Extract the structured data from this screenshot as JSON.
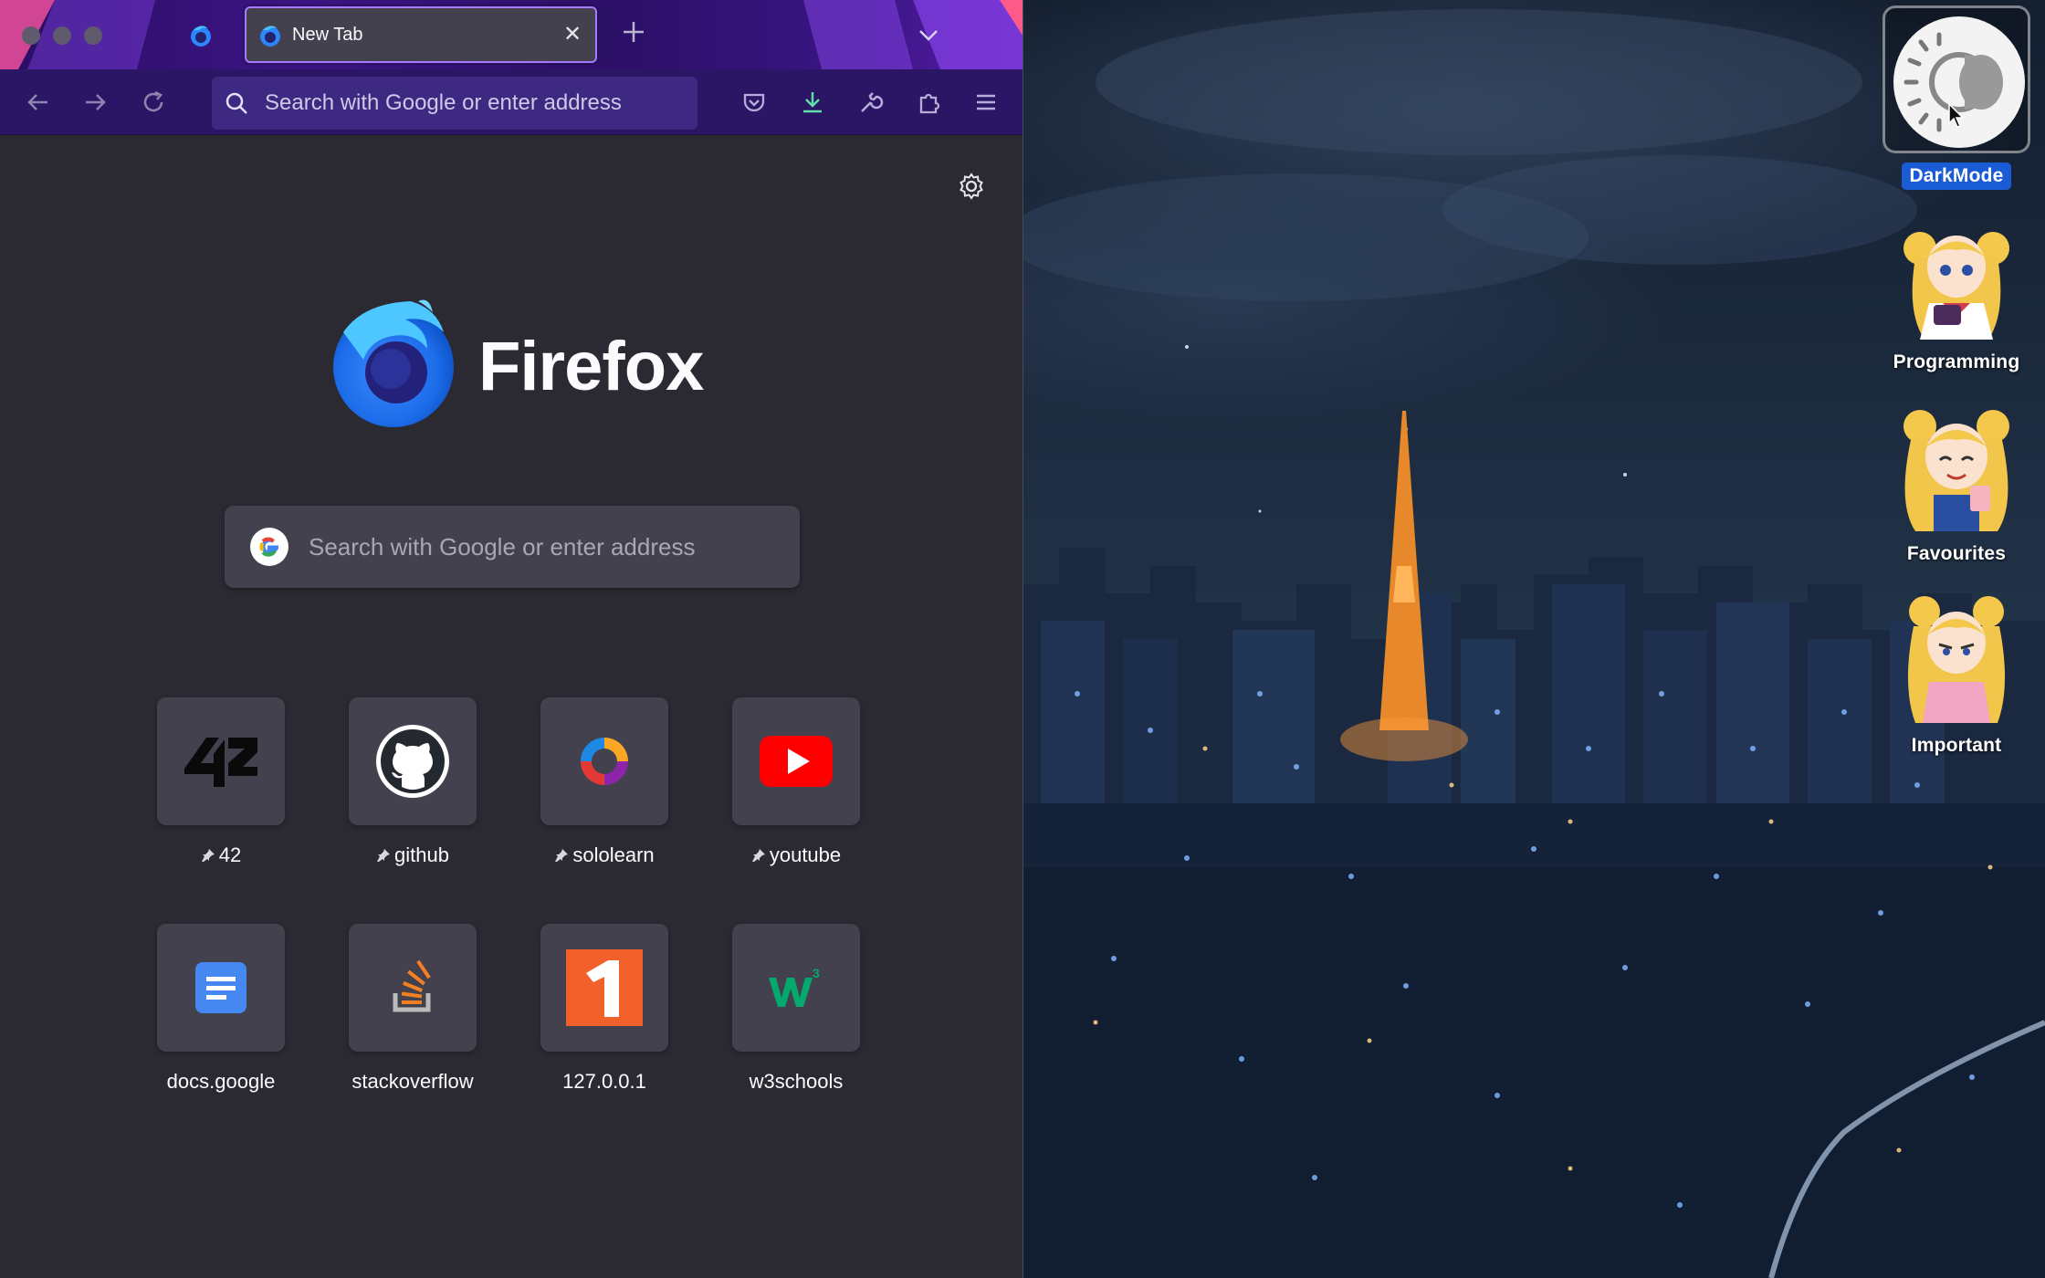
{
  "browser": {
    "active_tab": {
      "title": "New Tab"
    },
    "urlbar": {
      "placeholder": "Search with Google or enter address"
    },
    "new_tab_page": {
      "brand": "Firefox",
      "search_placeholder": "Search with Google or enter address",
      "top_sites": [
        {
          "label": "42",
          "pinned": true,
          "icon": "42-logo-icon"
        },
        {
          "label": "github",
          "pinned": true,
          "icon": "github-icon"
        },
        {
          "label": "sololearn",
          "pinned": true,
          "icon": "sololearn-icon"
        },
        {
          "label": "youtube",
          "pinned": true,
          "icon": "youtube-icon"
        },
        {
          "label": "docs.google",
          "pinned": false,
          "icon": "google-docs-icon"
        },
        {
          "label": "stackoverflow",
          "pinned": false,
          "icon": "stackoverflow-icon"
        },
        {
          "label": "127.0.0.1",
          "pinned": false,
          "icon": "number-one-icon"
        },
        {
          "label": "w3schools",
          "pinned": false,
          "icon": "w3schools-icon"
        }
      ]
    }
  },
  "desktop": {
    "icons": [
      {
        "label": "DarkMode",
        "selected": true,
        "icon": "dark-mode-toggle-icon"
      },
      {
        "label": "Programming",
        "selected": false,
        "icon": "anime-character-icon"
      },
      {
        "label": "Favourites",
        "selected": false,
        "icon": "anime-character-icon"
      },
      {
        "label": "Important",
        "selected": false,
        "icon": "anime-character-icon"
      }
    ]
  },
  "colors": {
    "titlebar": "#3b1483",
    "toolbar": "#2b1665",
    "page_background": "#2b2a33",
    "tile_background": "#42414d",
    "active_tab_outline": "#a57cff",
    "selection_label": "#1a5bd6"
  }
}
